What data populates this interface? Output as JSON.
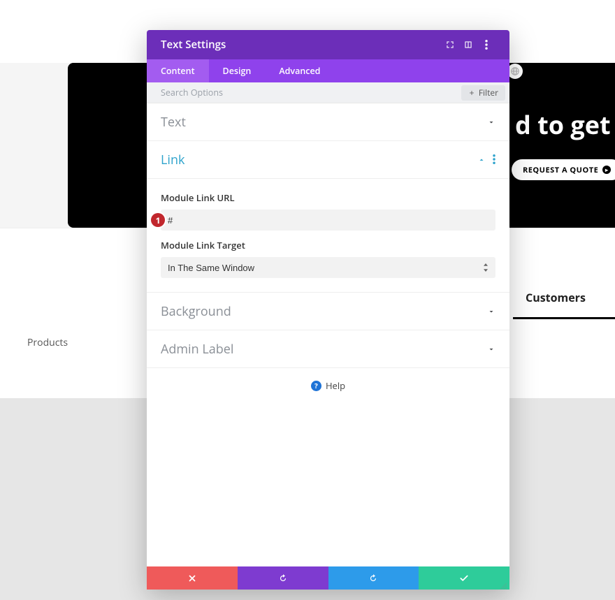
{
  "background": {
    "headline": "d to get start",
    "quote_button": "REQUEST A QUOTE",
    "products_label": "Products",
    "customers_label": "Customers"
  },
  "modal": {
    "title": "Text Settings",
    "tabs": {
      "content": "Content",
      "design": "Design",
      "advanced": "Advanced"
    },
    "search_placeholder": "Search Options",
    "filter_label": "Filter",
    "sections": {
      "text": "Text",
      "link": "Link",
      "background": "Background",
      "admin_label": "Admin Label"
    },
    "link": {
      "url_label": "Module Link URL",
      "url_value": "#",
      "target_label": "Module Link Target",
      "target_value": "In The Same Window"
    },
    "help_label": "Help",
    "badge_text": "1"
  }
}
